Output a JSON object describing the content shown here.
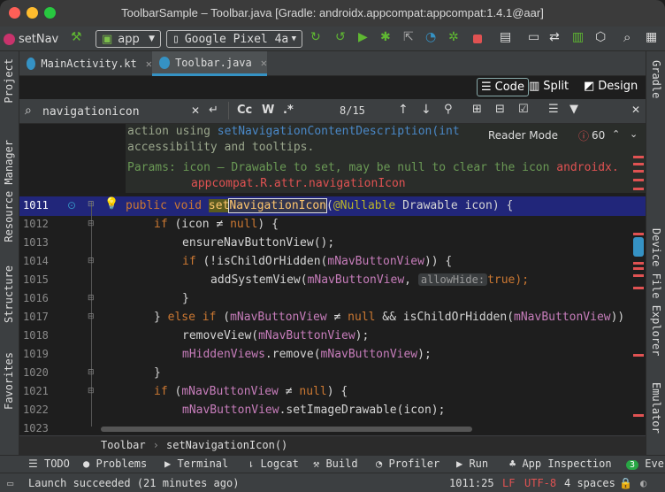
{
  "window": {
    "title": "ToolbarSample – Toolbar.java [Gradle: androidx.appcompat:appcompat:1.4.1@aar]"
  },
  "toolbar": {
    "project": "setNav",
    "config": "app",
    "device": "Google Pixel 4a"
  },
  "left_strip": {
    "project": "Project",
    "resource_manager": "Resource Manager",
    "structure": "Structure",
    "favorites": "Favorites"
  },
  "right_strip": {
    "gradle": "Gradle",
    "device_file_explorer": "Device File Explorer",
    "emulator": "Emulator"
  },
  "tabs": [
    {
      "label": "MainActivity.kt"
    },
    {
      "label": "Toolbar.java"
    }
  ],
  "view_modes": {
    "code": "Code",
    "split": "Split",
    "design": "Design"
  },
  "search": {
    "query": "navigationicon",
    "match_case": "Cc",
    "words": "W",
    "regex": ".*",
    "count": "8/15"
  },
  "reader": {
    "label": "Reader Mode",
    "errors": "60"
  },
  "doc": {
    "line1_a": "action using ",
    "line1_link": "setNavigationContentDescription(int",
    "line2": "accessibility and tooltips.",
    "line3_a": "Params: icon – Drawable to set, may be null to clear the icon ",
    "line3_b": "androidx.",
    "line4": "appcompat.R.attr.navigationIcon"
  },
  "line_numbers": [
    "1011",
    "1012",
    "1013",
    "1014",
    "1015",
    "1016",
    "1017",
    "1018",
    "1019",
    "1020",
    "1021",
    "1022",
    "1023"
  ],
  "code": {
    "l1011_kw": "public void ",
    "l1011_fn_a": "set",
    "l1011_fn_b": "NavigationIcon",
    "l1011_ann": "@Nullable",
    "l1011_rest": " Drawable icon) {",
    "l1012": "if (icon ≠ null) {",
    "l1013": "ensureNavButtonView();",
    "l1014_a": "if (!isChildOrHidden(",
    "l1014_f": "mNavButtonView",
    "l1014_b": ")) {",
    "l1015_a": "addSystemView(",
    "l1015_f": "mNavButtonView",
    "l1015_hint": "allowHide:",
    "l1015_b": "true);",
    "l1016": "}",
    "l1017_a": "} else if (",
    "l1017_f": "mNavButtonView",
    "l1017_b": " ≠ null && isChildOrHidden(",
    "l1017_c": "mNavButtonView",
    "l1017_d": "))",
    "l1018_a": "removeView(",
    "l1018_f": "mNavButtonView",
    "l1018_b": ");",
    "l1019_f": "mHiddenViews",
    "l1019_a": ".remove(",
    "l1019_g": "mNavButtonView",
    "l1019_b": ");",
    "l1020": "}",
    "l1021_a": "if (",
    "l1021_f": "mNavButtonView",
    "l1021_b": " ≠ null) {",
    "l1022_f": "mNavButtonView",
    "l1022_a": ".setImageDrawable(icon);"
  },
  "breadcrumb": {
    "class": "Toolbar",
    "method": "setNavigationIcon()"
  },
  "bottom_tools": [
    "TODO",
    "Problems",
    "Terminal",
    "Logcat",
    "Build",
    "Profiler",
    "Run",
    "App Inspection",
    "Event"
  ],
  "event_count": "3",
  "status": {
    "message": "Launch succeeded (21 minutes ago)",
    "position": "1011:25",
    "line_sep": "LF",
    "encoding": "UTF-8",
    "indent": "4 spaces"
  },
  "colors": {
    "accent": "#3592c4",
    "highlight_line": "#21267a",
    "error": "#e05252",
    "keyword": "#cc7832",
    "field": "#c77dbb"
  }
}
